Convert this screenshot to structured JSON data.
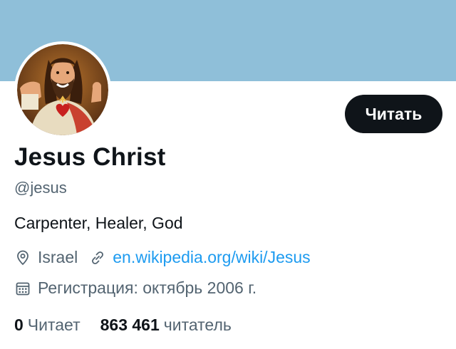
{
  "colors": {
    "banner": "#8fbfd9",
    "text_primary": "#0f1419",
    "text_secondary": "#536471",
    "link": "#1d9bf0",
    "button_bg": "#0f1419",
    "button_text": "#ffffff"
  },
  "profile": {
    "name": "Jesus Christ",
    "handle": "@jesus",
    "bio": "Carpenter, Healer, God",
    "location": "Israel",
    "website": "en.wikipedia.org/wiki/Jesus",
    "joined": "Регистрация: октябрь 2006 г."
  },
  "actions": {
    "follow_label": "Читать"
  },
  "stats": {
    "following_count": "0",
    "following_label": "Читает",
    "followers_count": "863 461",
    "followers_label": "читатель"
  },
  "icons": {
    "location": "location-pin-icon",
    "website": "link-icon",
    "joined": "calendar-icon"
  }
}
